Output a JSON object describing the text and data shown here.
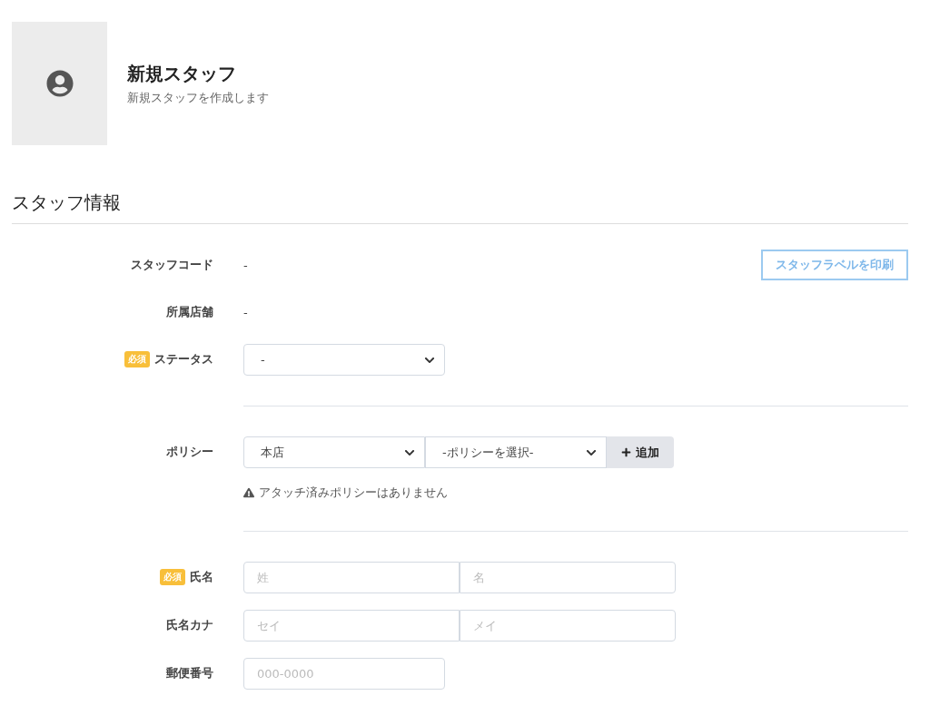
{
  "header": {
    "title": "新規スタッフ",
    "subtitle": "新規スタッフを作成します"
  },
  "section": {
    "title": "スタッフ情報"
  },
  "rows": [
    {
      "kind": "text",
      "label": "スタッフコード",
      "value": "-",
      "action": "スタッフラベルを印刷"
    },
    {
      "kind": "text",
      "label": "所属店舗",
      "value": "-"
    },
    {
      "kind": "select",
      "label": "ステータス",
      "badge": "必須",
      "value": "-"
    },
    {
      "kind": "divider"
    },
    {
      "kind": "policy",
      "label": "ポリシー",
      "store": "本店",
      "policy": "-ポリシーを選択-",
      "add": "追加",
      "notice": "アタッチ済みポリシーはありません"
    },
    {
      "kind": "divider"
    },
    {
      "kind": "pair",
      "label": "氏名",
      "badge": "必須",
      "placeholders": [
        "姓",
        "名"
      ]
    },
    {
      "kind": "pair",
      "label": "氏名カナ",
      "placeholders": [
        "セイ",
        "メイ"
      ]
    },
    {
      "kind": "input",
      "label": "郵便番号",
      "placeholder": "000-0000"
    }
  ]
}
